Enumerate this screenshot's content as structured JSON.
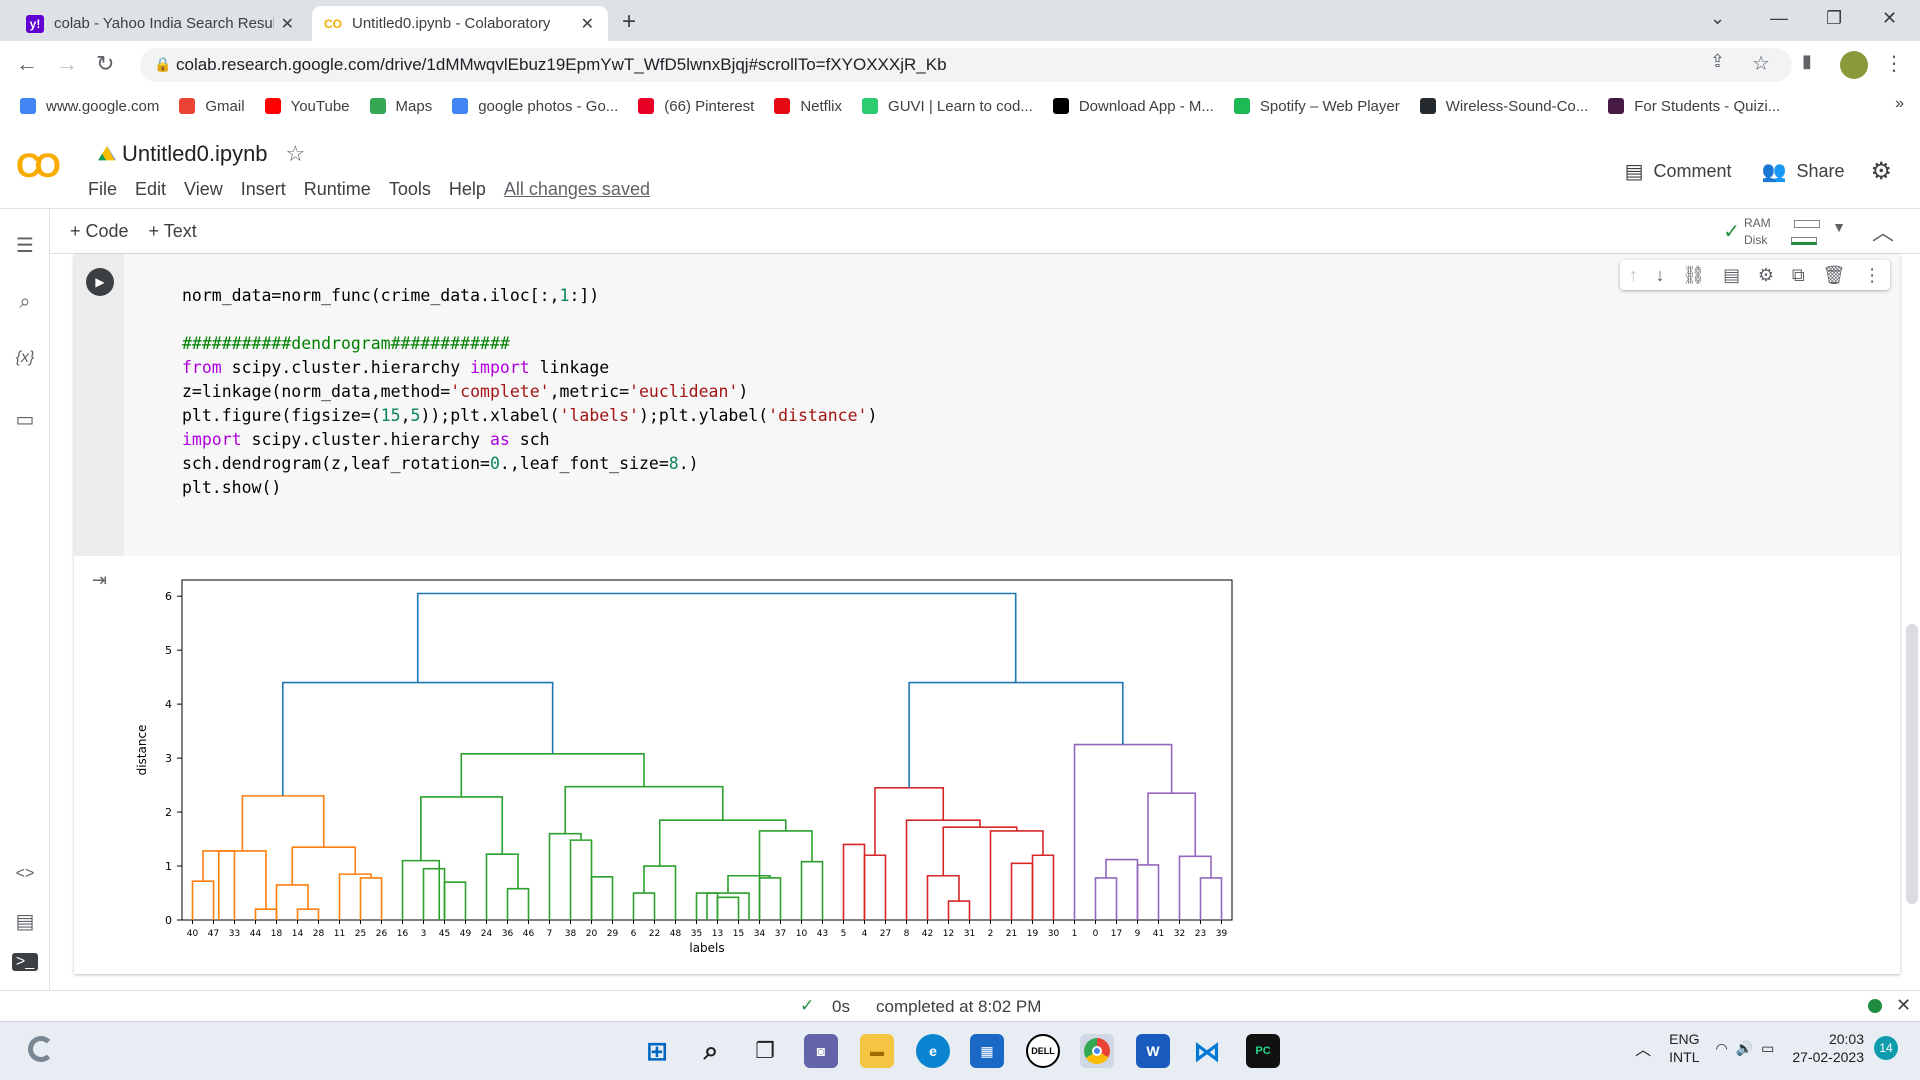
{
  "browser": {
    "tabs": [
      {
        "title": "colab - Yahoo India Search Results",
        "icon": "yahoo-icon"
      },
      {
        "title": "Untitled0.ipynb - Colaboratory",
        "icon": "colab-icon"
      }
    ],
    "url": "colab.research.google.com/drive/1dMMwqvlEbuz19EpmYwT_WfD5lwnxBjqj#scrollTo=fXYOXXXjR_Kb",
    "bookmarks": [
      {
        "label": "www.google.com",
        "icon": "google-icon",
        "color": "#4285f4"
      },
      {
        "label": "Gmail",
        "icon": "gmail-icon",
        "color": "#ea4335"
      },
      {
        "label": "YouTube",
        "icon": "youtube-icon",
        "color": "#ff0000"
      },
      {
        "label": "Maps",
        "icon": "maps-icon",
        "color": "#34a853"
      },
      {
        "label": "google photos - Go...",
        "icon": "google-icon",
        "color": "#4285f4"
      },
      {
        "label": "(66) Pinterest",
        "icon": "pinterest-icon",
        "color": "#e60023"
      },
      {
        "label": "Netflix",
        "icon": "netflix-icon",
        "color": "#e50914"
      },
      {
        "label": "GUVI | Learn to cod...",
        "icon": "guvi-icon",
        "color": "#2ecc71"
      },
      {
        "label": "Download App - M...",
        "icon": "download-icon",
        "color": "#000000"
      },
      {
        "label": "Spotify – Web Player",
        "icon": "spotify-icon",
        "color": "#1db954"
      },
      {
        "label": "Wireless-Sound-Co...",
        "icon": "github-icon",
        "color": "#24292e"
      },
      {
        "label": "For Students - Quizi...",
        "icon": "quizizz-icon",
        "color": "#461a42"
      }
    ]
  },
  "colab": {
    "logo": "CO",
    "notebook_name": "Untitled0.ipynb",
    "menus": [
      "File",
      "Edit",
      "View",
      "Insert",
      "Runtime",
      "Tools",
      "Help"
    ],
    "save_status": "All changes saved",
    "comment_label": "Comment",
    "share_label": "Share",
    "add_code": "+ Code",
    "add_text": "+ Text",
    "ram_label": "RAM",
    "disk_label": "Disk",
    "exec_time": "0s",
    "completed": "completed at 8:02 PM"
  },
  "code_lines": [
    "norm_data=norm_func(crime_data.iloc[:,1:])",
    "",
    "###########dendrogram############",
    "from scipy.cluster.hierarchy import linkage",
    "z=linkage(norm_data,method='complete',metric='euclidean')",
    "plt.figure(figsize=(15,5));plt.xlabel('labels');plt.ylabel('distance')",
    "import scipy.cluster.hierarchy as sch",
    "sch.dendrogram(z,leaf_rotation=0.,leaf_font_size=8.)",
    "plt.show()"
  ],
  "chart_data": {
    "type": "dendrogram",
    "xlabel": "labels",
    "ylabel": "distance",
    "ylim": [
      0,
      6.3
    ],
    "yticks": [
      0,
      1,
      2,
      3,
      4,
      5,
      6
    ],
    "leaves": [
      "40",
      "47",
      "33",
      "44",
      "18",
      "14",
      "28",
      "11",
      "25",
      "26",
      "16",
      "3",
      "45",
      "49",
      "24",
      "36",
      "46",
      "7",
      "38",
      "20",
      "29",
      "6",
      "22",
      "48",
      "35",
      "13",
      "15",
      "34",
      "37",
      "10",
      "43",
      "5",
      "4",
      "27",
      "8",
      "42",
      "12",
      "31",
      "2",
      "21",
      "19",
      "30",
      "1",
      "0",
      "17",
      "9",
      "41",
      "32",
      "23",
      "39"
    ],
    "cluster_colors": {
      "orange": "#ff7f0e",
      "green": "#2ca02c",
      "red": "#d62728",
      "purple": "#9467bd",
      "blue": "#1f77b4"
    },
    "merges": [
      {
        "x1": 0,
        "x2": 1,
        "h": 0.72,
        "c": "orange"
      },
      {
        "x1": 0.5,
        "x2": 2,
        "h": 1.28,
        "c": "orange"
      },
      {
        "x1": 3,
        "x2": 4,
        "h": 0.2,
        "c": "orange"
      },
      {
        "x1": 1.25,
        "x2": 3.5,
        "h": 1.28,
        "c": "orange"
      },
      {
        "x1": 5,
        "x2": 6,
        "h": 0.2,
        "c": "orange"
      },
      {
        "x1": 4,
        "x2": 5.5,
        "h": 0.65,
        "c": "orange"
      },
      {
        "x1": 8,
        "x2": 9,
        "h": 0.78,
        "c": "orange"
      },
      {
        "x1": 7,
        "x2": 8.5,
        "h": 0.85,
        "c": "orange"
      },
      {
        "x1": 4.75,
        "x2": 7.75,
        "h": 1.35,
        "c": "orange"
      },
      {
        "x1": 2.375,
        "x2": 6.25,
        "h": 2.3,
        "c": "orange"
      },
      {
        "x1": 11,
        "x2": 12,
        "h": 0.95,
        "c": "green"
      },
      {
        "x1": 12,
        "x2": 13,
        "h": 0.7,
        "c": "green"
      },
      {
        "x1": 10,
        "x2": 11.75,
        "h": 1.1,
        "c": "green"
      },
      {
        "x1": 15,
        "x2": 16,
        "h": 0.58,
        "c": "green"
      },
      {
        "x1": 14,
        "x2": 15.5,
        "h": 1.22,
        "c": "green"
      },
      {
        "x1": 10.875,
        "x2": 14.75,
        "h": 2.28,
        "c": "green"
      },
      {
        "x1": 18,
        "x2": 19,
        "h": 1.48,
        "c": "green"
      },
      {
        "x1": 17,
        "x2": 18.5,
        "h": 1.6,
        "c": "green"
      },
      {
        "x1": 19,
        "x2": 20,
        "h": 0.8,
        "c": "green"
      },
      {
        "x1": 21,
        "x2": 22,
        "h": 0.5,
        "c": "green"
      },
      {
        "x1": 21.5,
        "x2": 23,
        "h": 1.0,
        "c": "green"
      },
      {
        "x1": 24,
        "x2": 25,
        "h": 0.5,
        "c": "green"
      },
      {
        "x1": 25,
        "x2": 26,
        "h": 0.42,
        "c": "green"
      },
      {
        "x1": 24.5,
        "x2": 26.5,
        "h": 0.5,
        "c": "green"
      },
      {
        "x1": 27,
        "x2": 28,
        "h": 0.78,
        "c": "green"
      },
      {
        "x1": 25.5,
        "x2": 27.5,
        "h": 0.82,
        "c": "green"
      },
      {
        "x1": 29,
        "x2": 30,
        "h": 1.08,
        "c": "green"
      },
      {
        "x1": 27.0,
        "x2": 29.5,
        "h": 1.65,
        "c": "green"
      },
      {
        "x1": 22.25,
        "x2": 28.25,
        "h": 1.85,
        "c": "green"
      },
      {
        "x1": 17.75,
        "x2": 25.25,
        "h": 2.47,
        "c": "green"
      },
      {
        "x1": 12.8,
        "x2": 21.5,
        "h": 3.08,
        "c": "green"
      },
      {
        "x1": 4.3,
        "x2": 17.15,
        "h": 4.4,
        "c": "blue"
      },
      {
        "x1": 31,
        "x2": 32,
        "h": 1.4,
        "c": "red"
      },
      {
        "x1": 32,
        "x2": 33,
        "h": 1.2,
        "c": "red"
      },
      {
        "x1": 36,
        "x2": 37,
        "h": 0.35,
        "c": "red"
      },
      {
        "x1": 35,
        "x2": 36.5,
        "h": 0.82,
        "c": "red"
      },
      {
        "x1": 39,
        "x2": 40,
        "h": 1.05,
        "c": "red"
      },
      {
        "x1": 40,
        "x2": 41,
        "h": 1.2,
        "c": "red"
      },
      {
        "x1": 38,
        "x2": 40.5,
        "h": 1.65,
        "c": "red"
      },
      {
        "x1": 35.75,
        "x2": 39.25,
        "h": 1.72,
        "c": "red"
      },
      {
        "x1": 34,
        "x2": 37.5,
        "h": 1.85,
        "c": "red"
      },
      {
        "x1": 32.5,
        "x2": 35.75,
        "h": 2.45,
        "c": "red"
      },
      {
        "x1": 43,
        "x2": 44,
        "h": 0.78,
        "c": "purple"
      },
      {
        "x1": 43.5,
        "x2": 45,
        "h": 1.12,
        "c": "purple"
      },
      {
        "x1": 45,
        "x2": 46,
        "h": 1.02,
        "c": "purple"
      },
      {
        "x1": 48,
        "x2": 49,
        "h": 0.78,
        "c": "purple"
      },
      {
        "x1": 47,
        "x2": 48.5,
        "h": 1.18,
        "c": "purple"
      },
      {
        "x1": 45.5,
        "x2": 47.75,
        "h": 2.35,
        "c": "purple"
      },
      {
        "x1": 42,
        "x2": 46.625,
        "h": 3.25,
        "c": "purple"
      },
      {
        "x1": 34.125,
        "x2": 44.3,
        "h": 4.4,
        "c": "blue"
      },
      {
        "x1": 10.725,
        "x2": 39.2,
        "h": 6.05,
        "c": "blue"
      }
    ]
  },
  "taskbar": {
    "lang1": "ENG",
    "lang2": "INTL",
    "time": "20:03",
    "date": "27-02-2023",
    "notif": "14"
  }
}
